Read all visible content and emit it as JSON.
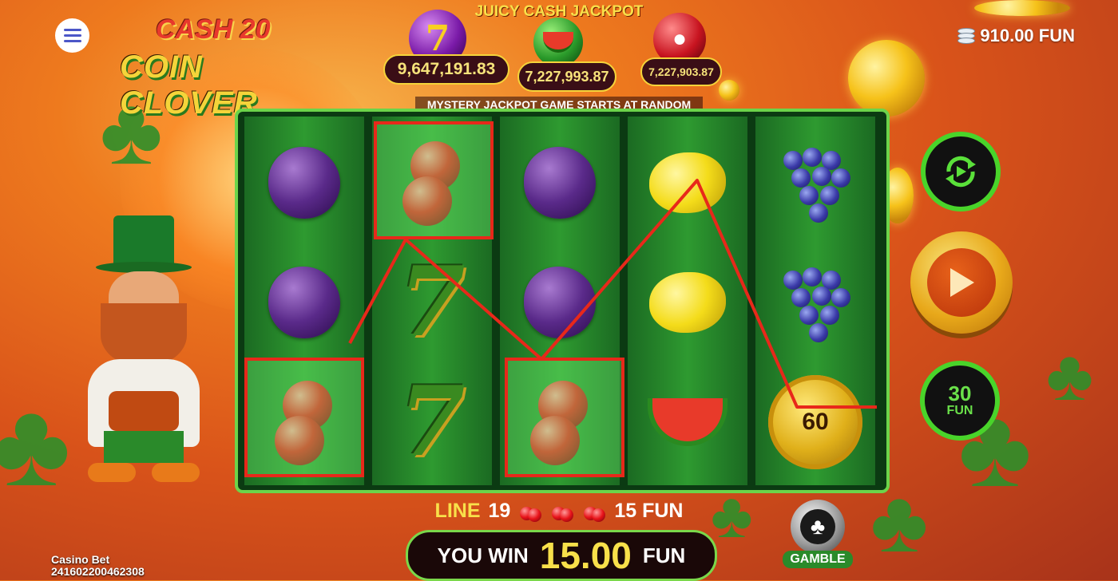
{
  "game": {
    "logo_line1": "CASH 20",
    "logo_line2": "COIN CLOVER"
  },
  "balance": {
    "amount": "910.00 FUN",
    "icon": "coin-stack-icon"
  },
  "jackpot": {
    "title": "JUICY CASH JACKPOT",
    "items": [
      {
        "symbol": "seven-icon",
        "value": "9,647,191.83",
        "color": "#7a1aa8"
      },
      {
        "symbol": "watermelon-icon",
        "value": "7,227,993.87",
        "color": "#2a9a2a"
      },
      {
        "symbol": "cherry-icon",
        "value": "7,227,903.87",
        "color": "#c81420"
      }
    ],
    "mystery_text": "MYSTERY JACKPOT GAME STARTS AT RANDOM"
  },
  "reels": [
    [
      "plum",
      "plum",
      "cherry"
    ],
    [
      "cherry",
      "seven",
      "seven"
    ],
    [
      "plum",
      "plum",
      "cherry"
    ],
    [
      "lemon",
      "lemon",
      "watermelon"
    ],
    [
      "grapes",
      "grapes",
      "coin"
    ]
  ],
  "coin_value": "60",
  "winning_line": {
    "label": "LINE",
    "number": "19",
    "amount": "15 FUN",
    "symbol": "cherry-icon",
    "symbol_count": 3
  },
  "win": {
    "prefix": "YOU WIN",
    "amount": "15.00",
    "currency": "FUN"
  },
  "controls": {
    "autoplay_icon": "autoplay-icon",
    "spin_icon": "play-icon",
    "bet_amount": "30",
    "bet_currency": "FUN",
    "gamble_label": "GAMBLE"
  },
  "footer": {
    "casino_label": "Casino Bet",
    "round_id": "241602200462308"
  },
  "colors": {
    "reel_border": "#6cd44a",
    "win_line": "#e8281a",
    "accent_gold": "#f5d43a"
  }
}
